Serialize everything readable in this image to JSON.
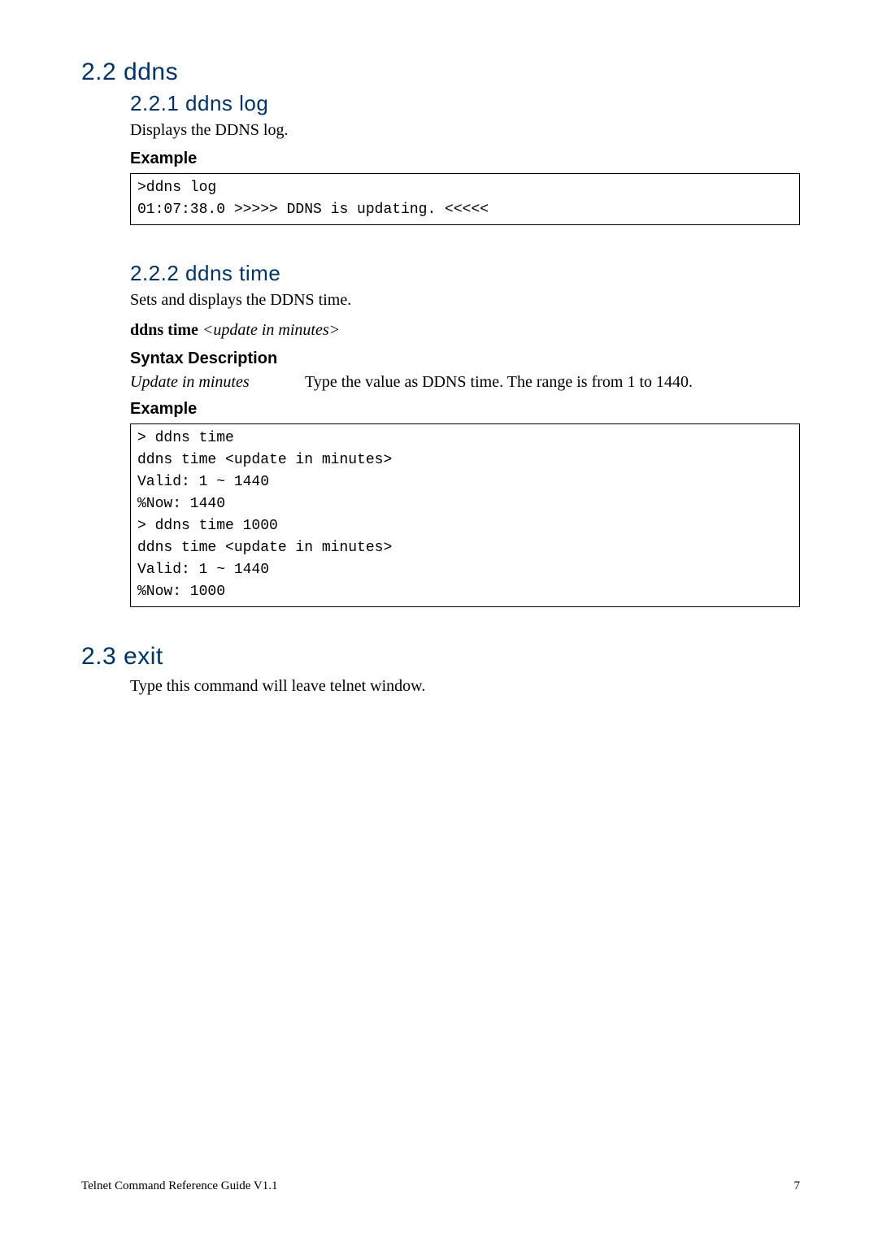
{
  "section22": {
    "heading": "2.2 ddns",
    "sub1": {
      "heading": "2.2.1 ddns log",
      "desc": "Displays the DDNS log.",
      "example_label": "Example",
      "example_code": ">ddns log\n01:07:38.0 >>>>> DDNS is updating. <<<<<"
    },
    "sub2": {
      "heading": "2.2.2 ddns time",
      "desc": "Sets and displays the DDNS time.",
      "syntax_bold": "ddns time ",
      "syntax_ital": "<update in minutes>",
      "syntax_label": "Syntax Description",
      "row_key": "Update in minutes",
      "row_val": "Type the value as DDNS time. The range is from 1 to 1440.",
      "example_label": "Example",
      "example_code": "> ddns time\nddns time <update in minutes>\nValid: 1 ~ 1440\n%Now: 1440\n> ddns time 1000\nddns time <update in minutes>\nValid: 1 ~ 1440\n%Now: 1000"
    }
  },
  "section23": {
    "heading": "2.3 exit",
    "body": "Type this command will leave telnet window."
  },
  "footer": {
    "left": "Telnet Command Reference Guide V1.1",
    "right": "7"
  }
}
